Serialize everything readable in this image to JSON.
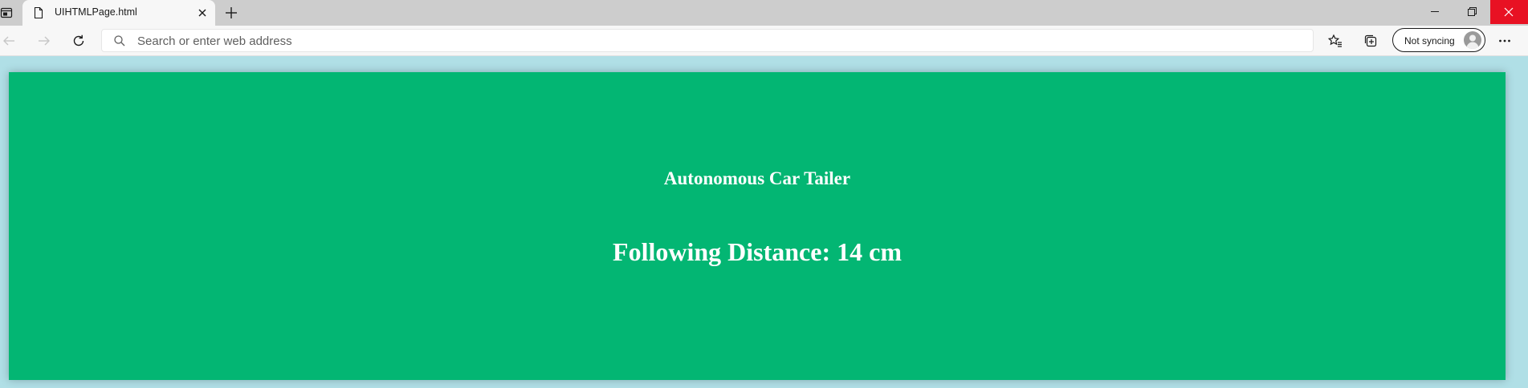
{
  "browser": {
    "tab": {
      "title": "UIHTMLPage.html"
    },
    "address_bar": {
      "placeholder": "Search or enter web address"
    },
    "profile": {
      "sync_label": "Not syncing"
    }
  },
  "page": {
    "title": "Autonomous Car Tailer",
    "distance": "Following Distance: 14 cm"
  },
  "colors": {
    "card": "#03b673",
    "page_background": "#b0dfe6",
    "close_button": "#e81123"
  }
}
